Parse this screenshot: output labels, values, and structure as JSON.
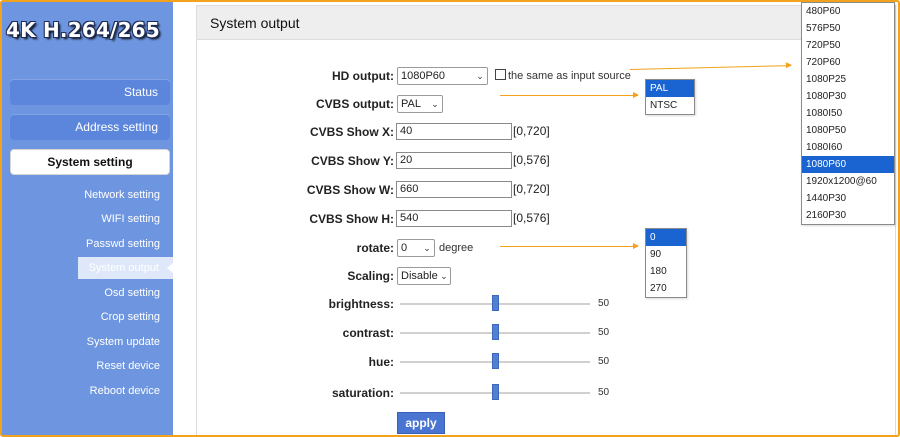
{
  "brand": "4K H.264/265",
  "menu": {
    "status": "Status",
    "address_setting": "Address setting",
    "system_setting": "System setting"
  },
  "submenu": [
    "Network setting",
    "WIFI setting",
    "Passwd setting",
    "System output",
    "Osd setting",
    "Crop setting",
    "System update",
    "Reset device",
    "Reboot device"
  ],
  "panel": {
    "title": "System output",
    "hd_output": {
      "label": "HD output:",
      "value": "1080P60",
      "same_as_input_label": "the same as input source"
    },
    "cvbs_output": {
      "label": "CVBS output:",
      "value": "PAL"
    },
    "cvbs_x": {
      "label": "CVBS Show X:",
      "value": "40",
      "range": "[0,720]"
    },
    "cvbs_y": {
      "label": "CVBS Show Y:",
      "value": "20",
      "range": "[0,576]"
    },
    "cvbs_w": {
      "label": "CVBS Show W:",
      "value": "660",
      "range": "[0,720]"
    },
    "cvbs_h": {
      "label": "CVBS Show H:",
      "value": "540",
      "range": "[0,576]"
    },
    "rotate": {
      "label": "rotate:",
      "value": "0",
      "unit": "degree"
    },
    "scaling": {
      "label": "Scaling:",
      "value": "Disable"
    },
    "brightness": {
      "label": "brightness:",
      "value": "50"
    },
    "contrast": {
      "label": "contrast:",
      "value": "50"
    },
    "hue": {
      "label": "hue:",
      "value": "50"
    },
    "saturation": {
      "label": "saturation:",
      "value": "50"
    },
    "apply_label": "apply"
  },
  "hd_output_options": [
    "480P60",
    "576P50",
    "720P50",
    "720P60",
    "1080P25",
    "1080P30",
    "1080I50",
    "1080P50",
    "1080I60",
    "1080P60",
    "1920x1200@60",
    "1440P30",
    "2160P30"
  ],
  "cvbs_options": [
    "PAL",
    "NTSC"
  ],
  "rotate_options": [
    "0",
    "90",
    "180",
    "270"
  ],
  "colors": {
    "accent": "#6e96e0",
    "selection": "#1a64d2",
    "annotation": "#f2a21c",
    "frame": "#f2a21c"
  }
}
